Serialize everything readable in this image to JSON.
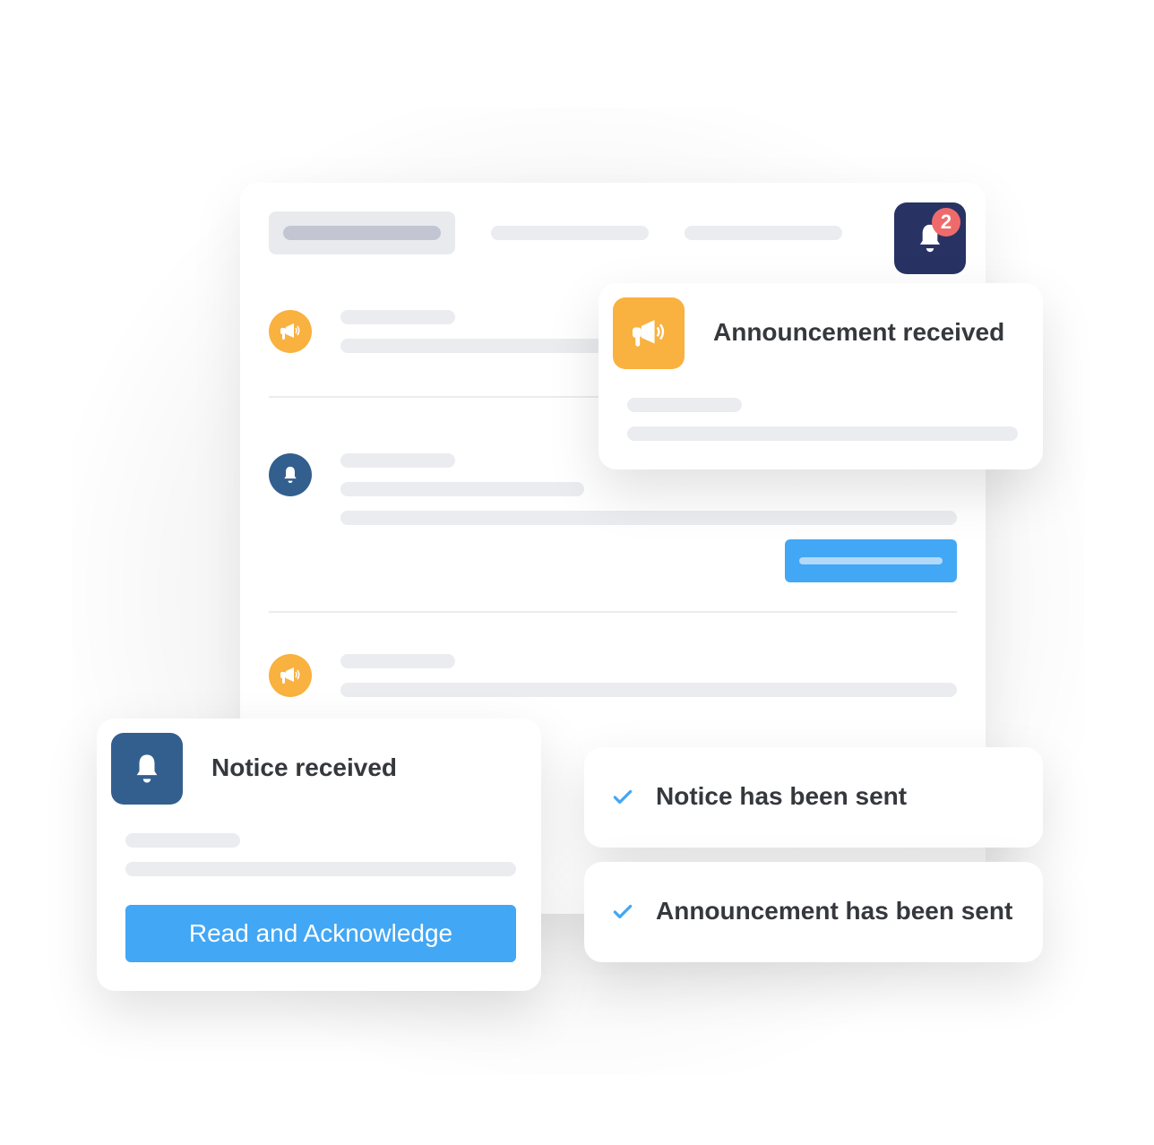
{
  "header": {
    "notification_count": "2"
  },
  "popups": {
    "announcement": {
      "title": "Announcement received"
    },
    "notice": {
      "title": "Notice received",
      "button_label": "Read and Acknowledge"
    }
  },
  "confirmations": [
    {
      "text": "Notice has been sent"
    },
    {
      "text": "Announcement has been sent"
    }
  ],
  "colors": {
    "announcement": "#f9b13f",
    "notice": "#335f8f",
    "accent": "#42a7f5",
    "badge": "#ef6b6b",
    "header_bell": "#283364"
  }
}
